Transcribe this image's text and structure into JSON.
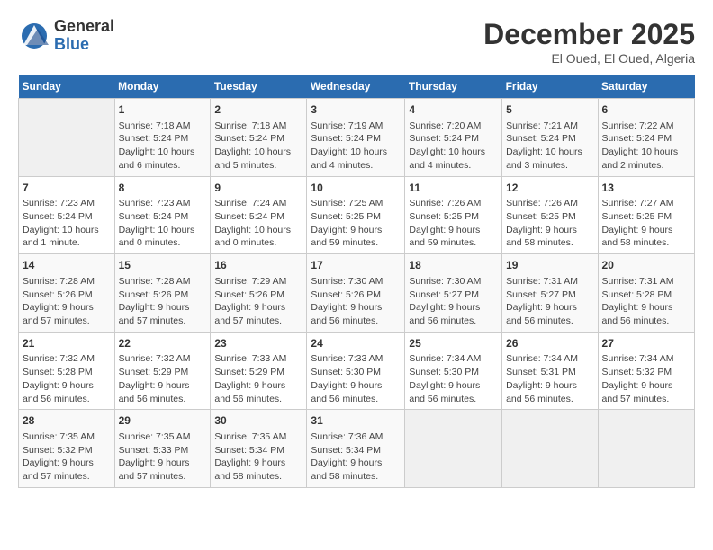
{
  "logo": {
    "line1": "General",
    "line2": "Blue"
  },
  "title": "December 2025",
  "location": "El Oued, El Oued, Algeria",
  "weekdays": [
    "Sunday",
    "Monday",
    "Tuesday",
    "Wednesday",
    "Thursday",
    "Friday",
    "Saturday"
  ],
  "weeks": [
    [
      {
        "day": "",
        "info": ""
      },
      {
        "day": "1",
        "info": "Sunrise: 7:18 AM\nSunset: 5:24 PM\nDaylight: 10 hours\nand 6 minutes."
      },
      {
        "day": "2",
        "info": "Sunrise: 7:18 AM\nSunset: 5:24 PM\nDaylight: 10 hours\nand 5 minutes."
      },
      {
        "day": "3",
        "info": "Sunrise: 7:19 AM\nSunset: 5:24 PM\nDaylight: 10 hours\nand 4 minutes."
      },
      {
        "day": "4",
        "info": "Sunrise: 7:20 AM\nSunset: 5:24 PM\nDaylight: 10 hours\nand 4 minutes."
      },
      {
        "day": "5",
        "info": "Sunrise: 7:21 AM\nSunset: 5:24 PM\nDaylight: 10 hours\nand 3 minutes."
      },
      {
        "day": "6",
        "info": "Sunrise: 7:22 AM\nSunset: 5:24 PM\nDaylight: 10 hours\nand 2 minutes."
      }
    ],
    [
      {
        "day": "7",
        "info": "Sunrise: 7:23 AM\nSunset: 5:24 PM\nDaylight: 10 hours\nand 1 minute."
      },
      {
        "day": "8",
        "info": "Sunrise: 7:23 AM\nSunset: 5:24 PM\nDaylight: 10 hours\nand 0 minutes."
      },
      {
        "day": "9",
        "info": "Sunrise: 7:24 AM\nSunset: 5:24 PM\nDaylight: 10 hours\nand 0 minutes."
      },
      {
        "day": "10",
        "info": "Sunrise: 7:25 AM\nSunset: 5:25 PM\nDaylight: 9 hours\nand 59 minutes."
      },
      {
        "day": "11",
        "info": "Sunrise: 7:26 AM\nSunset: 5:25 PM\nDaylight: 9 hours\nand 59 minutes."
      },
      {
        "day": "12",
        "info": "Sunrise: 7:26 AM\nSunset: 5:25 PM\nDaylight: 9 hours\nand 58 minutes."
      },
      {
        "day": "13",
        "info": "Sunrise: 7:27 AM\nSunset: 5:25 PM\nDaylight: 9 hours\nand 58 minutes."
      }
    ],
    [
      {
        "day": "14",
        "info": "Sunrise: 7:28 AM\nSunset: 5:26 PM\nDaylight: 9 hours\nand 57 minutes."
      },
      {
        "day": "15",
        "info": "Sunrise: 7:28 AM\nSunset: 5:26 PM\nDaylight: 9 hours\nand 57 minutes."
      },
      {
        "day": "16",
        "info": "Sunrise: 7:29 AM\nSunset: 5:26 PM\nDaylight: 9 hours\nand 57 minutes."
      },
      {
        "day": "17",
        "info": "Sunrise: 7:30 AM\nSunset: 5:26 PM\nDaylight: 9 hours\nand 56 minutes."
      },
      {
        "day": "18",
        "info": "Sunrise: 7:30 AM\nSunset: 5:27 PM\nDaylight: 9 hours\nand 56 minutes."
      },
      {
        "day": "19",
        "info": "Sunrise: 7:31 AM\nSunset: 5:27 PM\nDaylight: 9 hours\nand 56 minutes."
      },
      {
        "day": "20",
        "info": "Sunrise: 7:31 AM\nSunset: 5:28 PM\nDaylight: 9 hours\nand 56 minutes."
      }
    ],
    [
      {
        "day": "21",
        "info": "Sunrise: 7:32 AM\nSunset: 5:28 PM\nDaylight: 9 hours\nand 56 minutes."
      },
      {
        "day": "22",
        "info": "Sunrise: 7:32 AM\nSunset: 5:29 PM\nDaylight: 9 hours\nand 56 minutes."
      },
      {
        "day": "23",
        "info": "Sunrise: 7:33 AM\nSunset: 5:29 PM\nDaylight: 9 hours\nand 56 minutes."
      },
      {
        "day": "24",
        "info": "Sunrise: 7:33 AM\nSunset: 5:30 PM\nDaylight: 9 hours\nand 56 minutes."
      },
      {
        "day": "25",
        "info": "Sunrise: 7:34 AM\nSunset: 5:30 PM\nDaylight: 9 hours\nand 56 minutes."
      },
      {
        "day": "26",
        "info": "Sunrise: 7:34 AM\nSunset: 5:31 PM\nDaylight: 9 hours\nand 56 minutes."
      },
      {
        "day": "27",
        "info": "Sunrise: 7:34 AM\nSunset: 5:32 PM\nDaylight: 9 hours\nand 57 minutes."
      }
    ],
    [
      {
        "day": "28",
        "info": "Sunrise: 7:35 AM\nSunset: 5:32 PM\nDaylight: 9 hours\nand 57 minutes."
      },
      {
        "day": "29",
        "info": "Sunrise: 7:35 AM\nSunset: 5:33 PM\nDaylight: 9 hours\nand 57 minutes."
      },
      {
        "day": "30",
        "info": "Sunrise: 7:35 AM\nSunset: 5:34 PM\nDaylight: 9 hours\nand 58 minutes."
      },
      {
        "day": "31",
        "info": "Sunrise: 7:36 AM\nSunset: 5:34 PM\nDaylight: 9 hours\nand 58 minutes."
      },
      {
        "day": "",
        "info": ""
      },
      {
        "day": "",
        "info": ""
      },
      {
        "day": "",
        "info": ""
      }
    ]
  ]
}
